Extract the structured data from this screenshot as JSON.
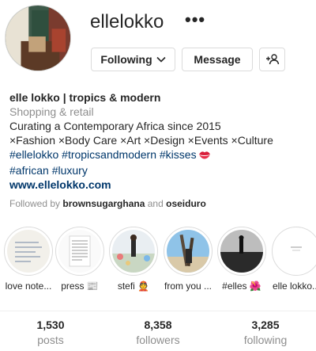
{
  "profile": {
    "username": "ellelokko",
    "more_icon": "more-options-icon"
  },
  "buttons": {
    "following": "Following",
    "message": "Message",
    "add_user_icon": "add-user-icon"
  },
  "bio": {
    "name": "elle lokko | tropics & modern",
    "category": "Shopping & retail",
    "line1": "Curating a Contemporary Africa since 2015",
    "line2": "×Fashion ×Body Care ×Art ×Design ×Events ×Culture",
    "tags1": "#ellelokko #tropicsandmodern #kisses",
    "tags1_emoji": "kiss-mark",
    "tags2": "#african #luxury",
    "link": "www.ellelokko.com"
  },
  "followed_by": {
    "prefix": "Followed by",
    "user1": "brownsugarghana",
    "conj": "and",
    "user2": "oseiduro"
  },
  "highlights": [
    {
      "label": "love note..."
    },
    {
      "label": "press 📰"
    },
    {
      "label": "stefi 👲"
    },
    {
      "label": "from you ..."
    },
    {
      "label": "#elles 🌺"
    },
    {
      "label": "elle lokko..."
    }
  ],
  "stats": {
    "posts": {
      "value": "1,530",
      "label": "posts"
    },
    "followers": {
      "value": "8,358",
      "label": "followers"
    },
    "following": {
      "value": "3,285",
      "label": "following"
    }
  },
  "colors": {
    "link": "#00376b",
    "muted": "#8e8e8e",
    "border": "#dbdbdb",
    "text": "#262626"
  }
}
